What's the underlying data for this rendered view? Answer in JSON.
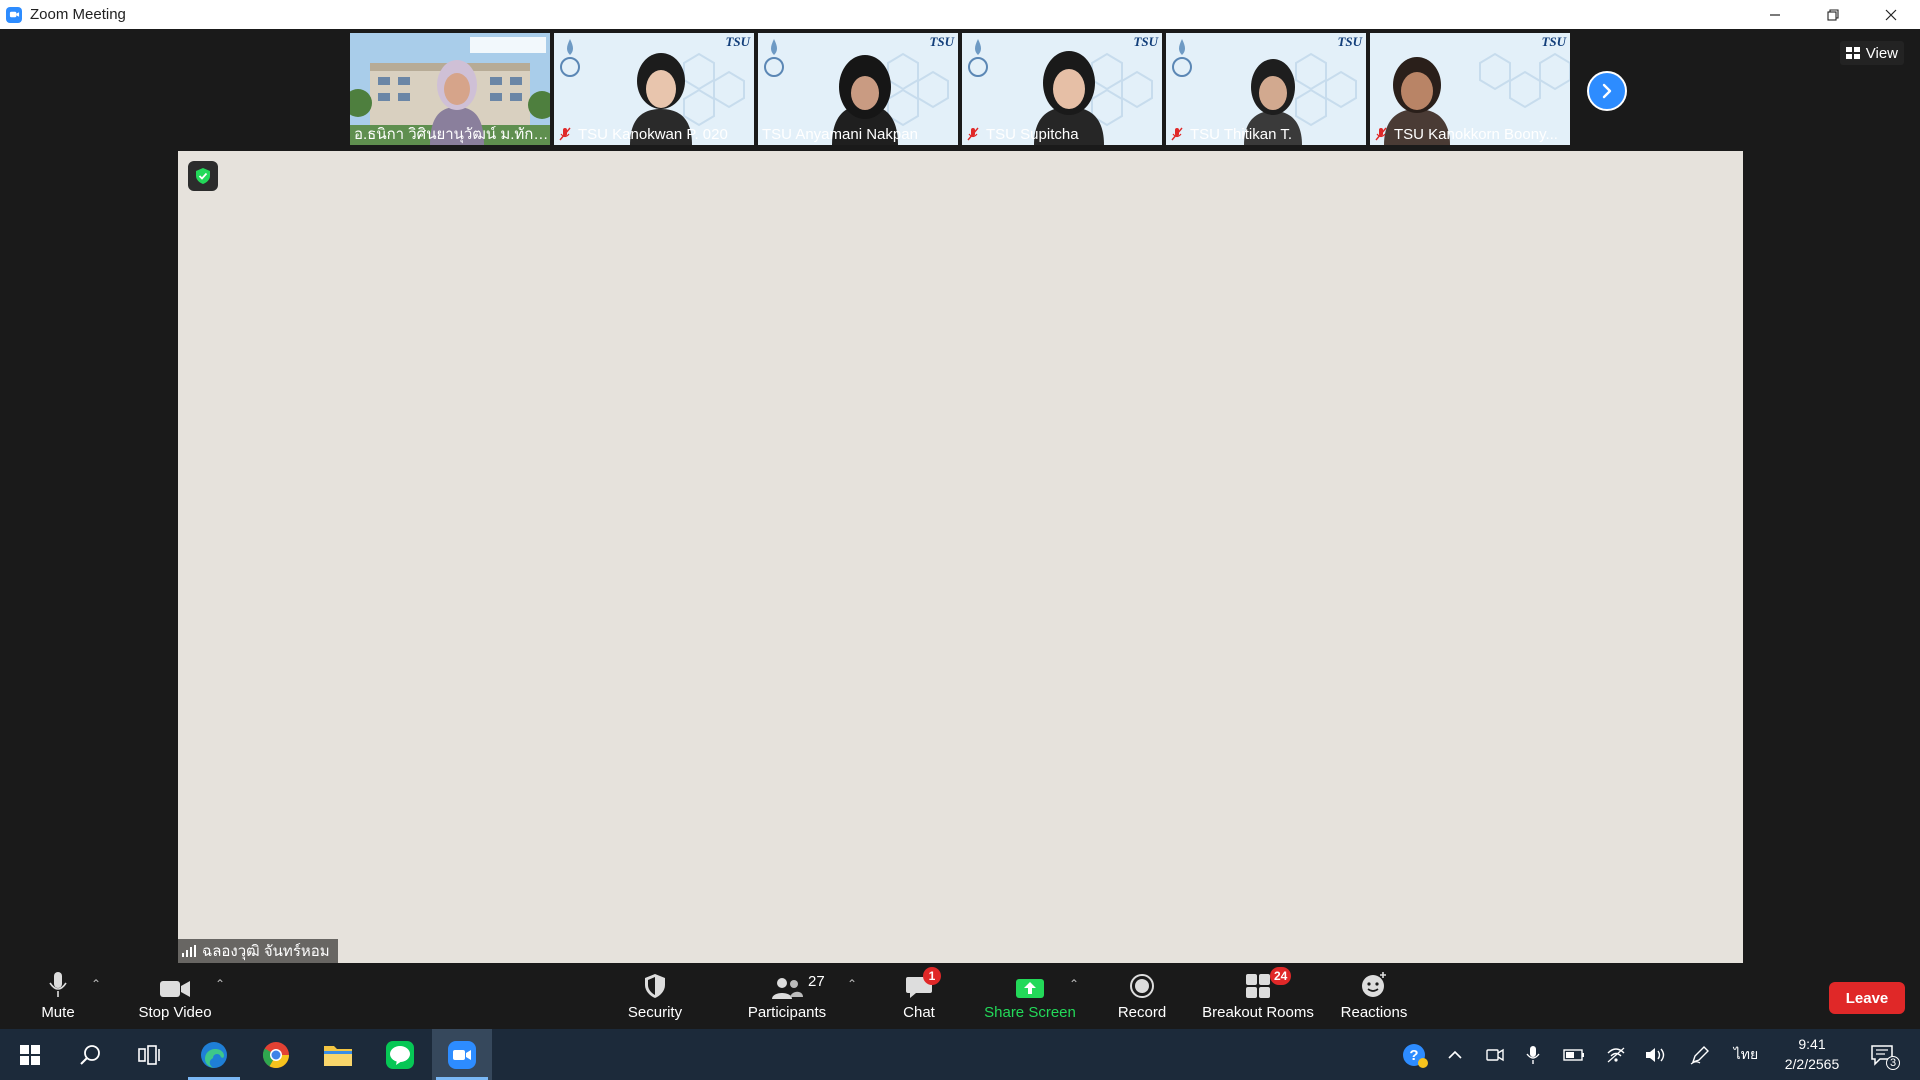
{
  "window": {
    "title": "Zoom Meeting"
  },
  "filmstrip": [
    {
      "name": "อ.ธนิกา  วิศินยานุวัฒน์ ม.ทักษิ...",
      "muted": false,
      "style": "building"
    },
    {
      "name": "TSU Kanokwan P. 020",
      "muted": true,
      "style": "logo"
    },
    {
      "name": "TSU Anyamani Nakpan",
      "muted": false,
      "style": "logo"
    },
    {
      "name": "TSU Supitcha",
      "muted": true,
      "style": "logo"
    },
    {
      "name": "TSU Thitikan T.",
      "muted": true,
      "style": "logo"
    },
    {
      "name": "TSU Kanokkorn Boony...",
      "muted": true,
      "style": "logo"
    }
  ],
  "thumb_brand": "TSU",
  "view_button": "View",
  "active_speaker": {
    "name": "ฉลองวุฒิ จันทร์หอม"
  },
  "toolbar": {
    "mute": "Mute",
    "stop_video": "Stop Video",
    "security": "Security",
    "participants": "Participants",
    "participants_count": "27",
    "chat": "Chat",
    "chat_badge": "1",
    "share_screen": "Share Screen",
    "record": "Record",
    "breakout_rooms": "Breakout Rooms",
    "breakout_badge": "24",
    "reactions": "Reactions",
    "leave": "Leave"
  },
  "taskbar": {
    "language": "ไทย",
    "time": "9:41",
    "date": "2/2/2565",
    "notification_count": "3"
  },
  "colors": {
    "accent": "#2d8cff",
    "leave": "#e02828",
    "share": "#23d959"
  }
}
